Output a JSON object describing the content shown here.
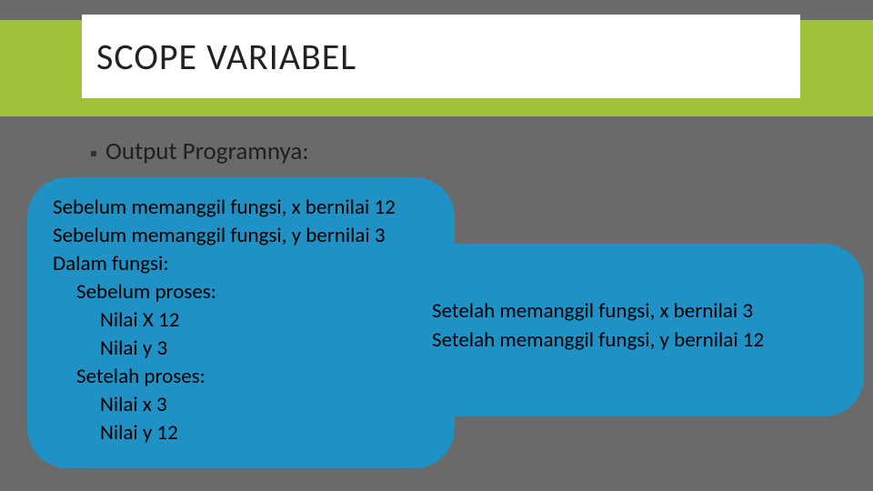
{
  "title": "SCOPE VARIABEL",
  "subtitle": "Output Programnya:",
  "left": {
    "l1": "Sebelum memanggil fungsi, x bernilai 12",
    "l2": "Sebelum memanggil fungsi, y bernilai 3",
    "l3": "Dalam fungsi:",
    "l4": "Sebelum proses:",
    "l5": "Nilai X 12",
    "l6": "Nilai y 3",
    "l7": "Setelah proses:",
    "l8": "Nilai x 3",
    "l9": "Nilai y 12"
  },
  "right": {
    "r1": "Setelah memanggil fungsi, x bernilai 3",
    "r2": "Setelah memanggil fungsi, y bernilai 12"
  }
}
